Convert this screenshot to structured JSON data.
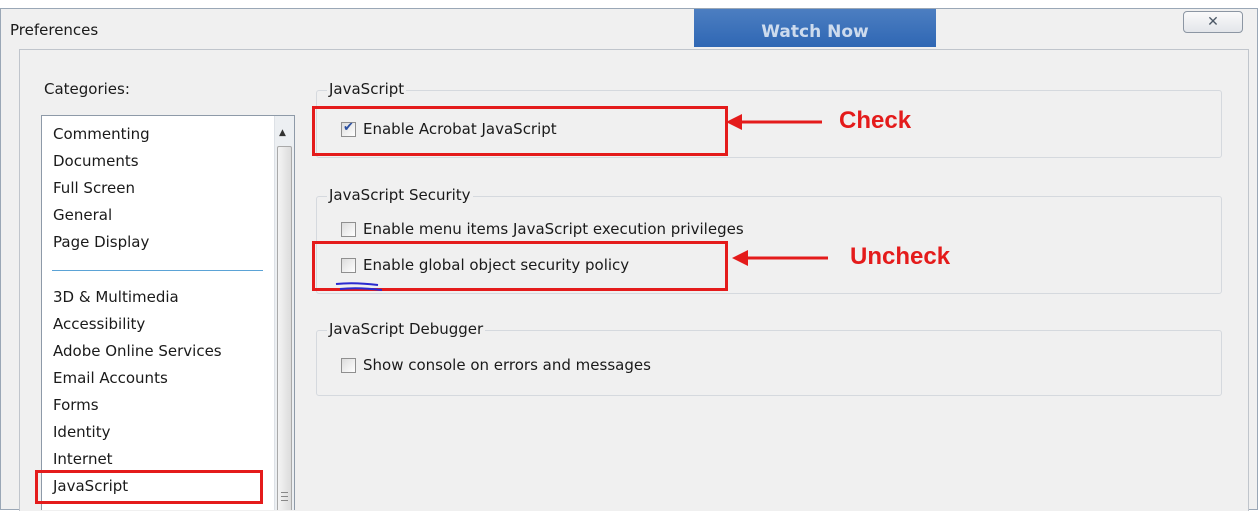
{
  "window": {
    "title": "Preferences",
    "overlay_button": "Watch Now",
    "close_glyph": "✕"
  },
  "sidebar": {
    "label": "Categories:",
    "items_top": [
      "Commenting",
      "Documents",
      "Full Screen",
      "General",
      "Page Display"
    ],
    "items_bottom": [
      "3D & Multimedia",
      "Accessibility",
      "Adobe Online Services",
      "Email Accounts",
      "Forms",
      "Identity",
      "Internet",
      "JavaScript"
    ],
    "selected": "JavaScript"
  },
  "sections": {
    "javascript": {
      "title": "JavaScript",
      "options": [
        {
          "label": "Enable Acrobat JavaScript",
          "checked": true
        }
      ]
    },
    "security": {
      "title": "JavaScript Security",
      "options": [
        {
          "label": "Enable menu items JavaScript execution privileges",
          "checked": false
        },
        {
          "label": "Enable global object security policy",
          "checked": false
        }
      ]
    },
    "debugger": {
      "title": "JavaScript Debugger",
      "options": [
        {
          "label": "Show console on errors and messages",
          "checked": false
        }
      ]
    }
  },
  "annotations": {
    "check": "Check",
    "uncheck": "Uncheck"
  },
  "icons": {
    "check_mark": "check-mark-icon",
    "scroll_up": "scroll-up-arrow-icon",
    "close": "close-icon"
  },
  "colors": {
    "annotation": "#e41b1b",
    "title_bar": "#f0f0f0",
    "accent": "#2f67b4"
  }
}
